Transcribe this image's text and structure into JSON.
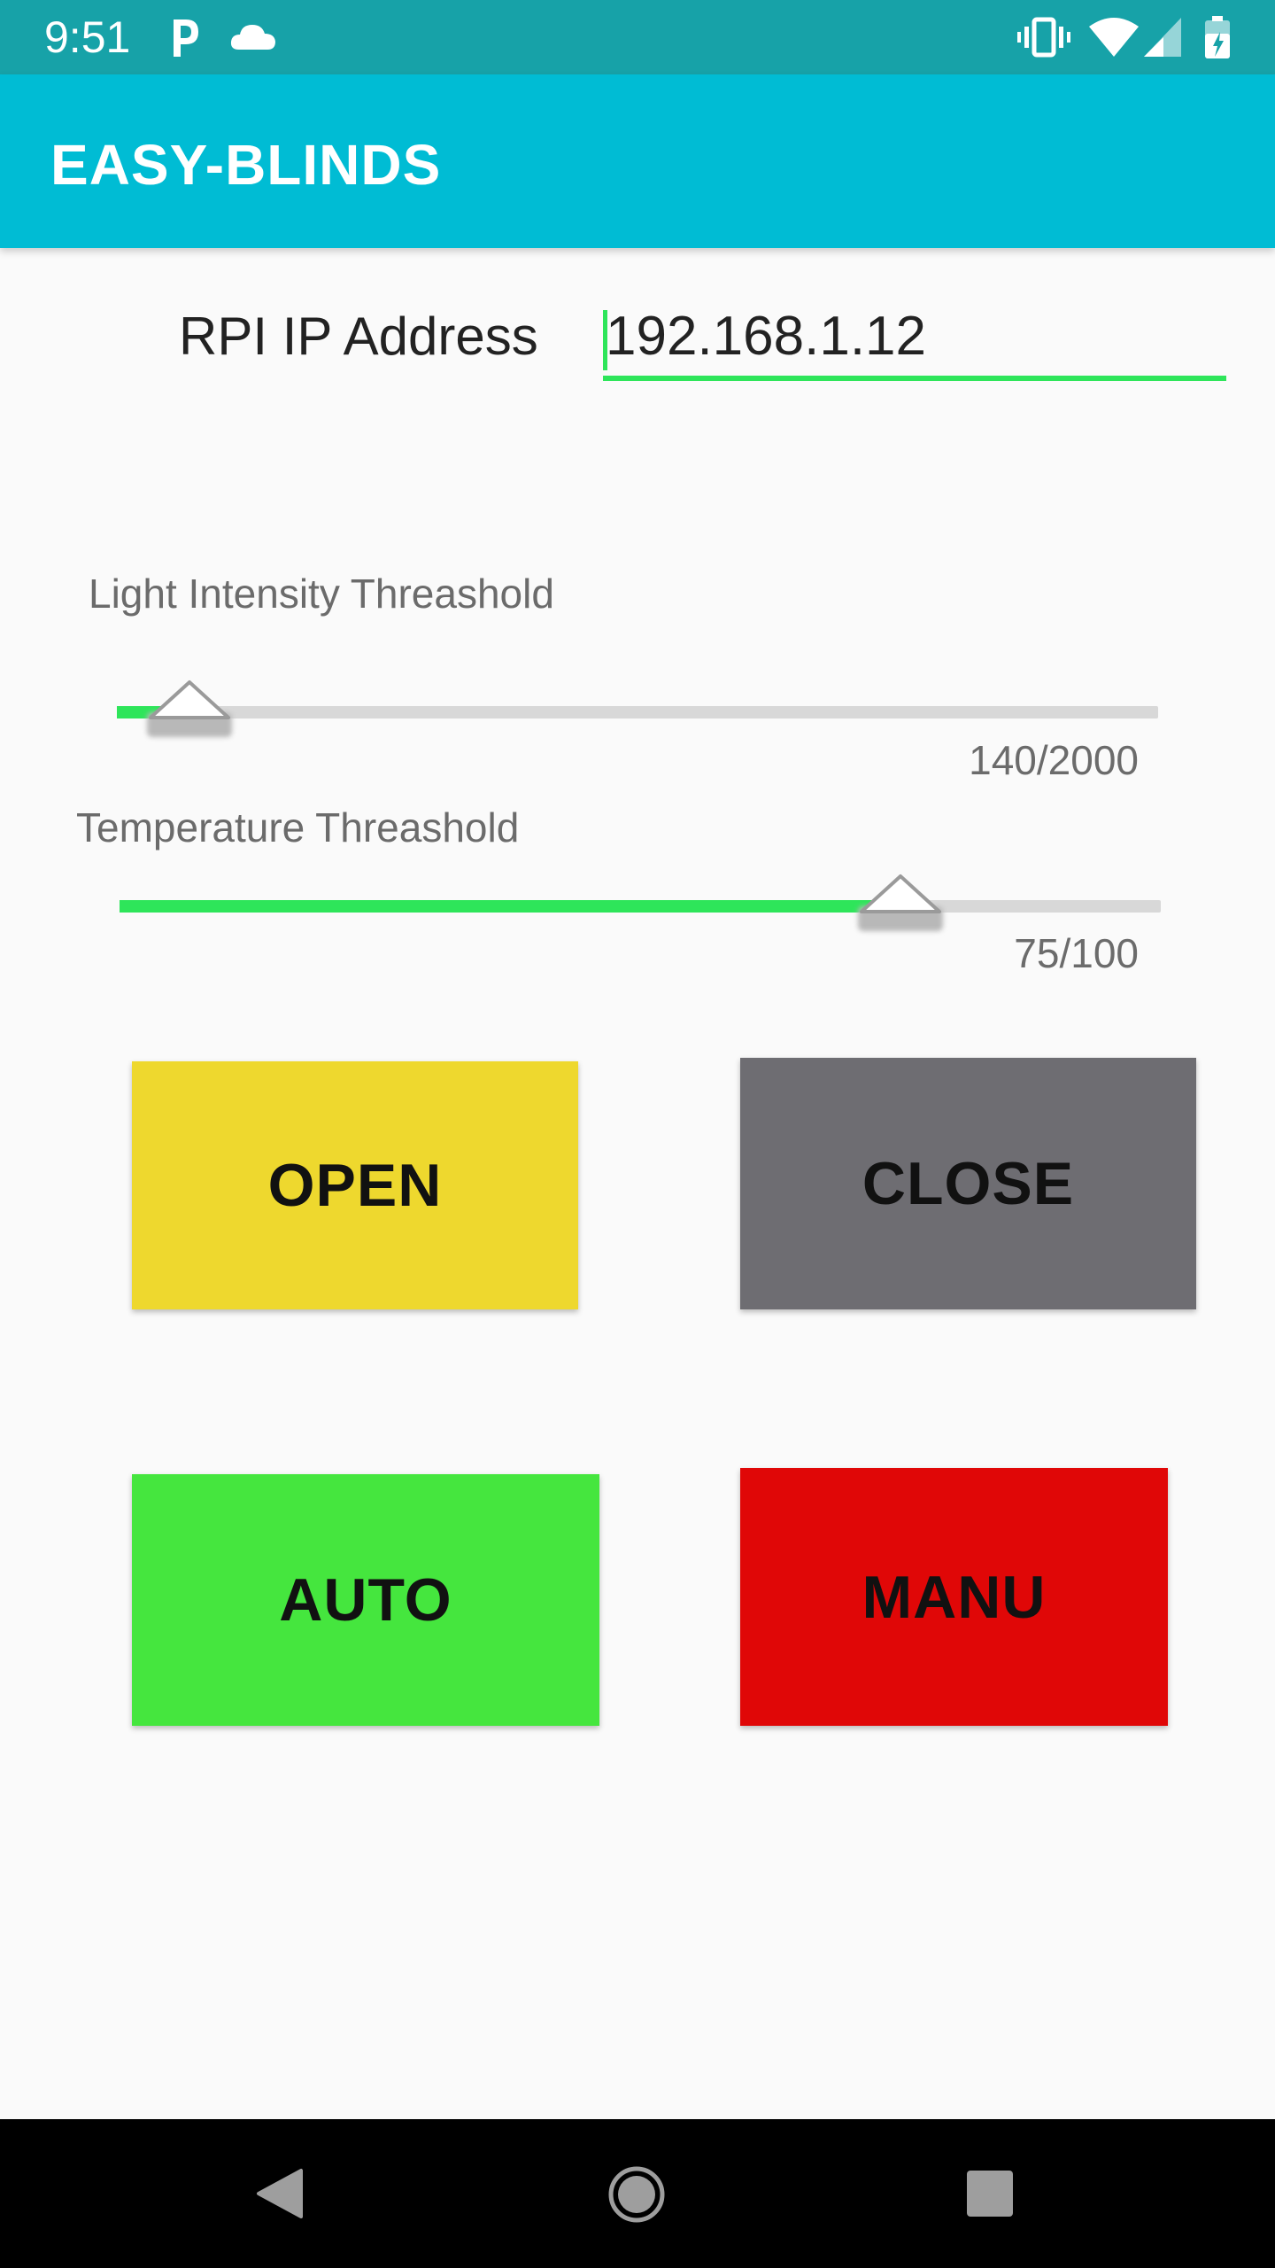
{
  "status_bar": {
    "time": "9:51",
    "icons": [
      "parking-app-icon",
      "cloud-icon",
      "vibrate-icon",
      "wifi-icon",
      "cell-signal-icon",
      "battery-icon"
    ]
  },
  "app_bar": {
    "title": "EASY-BLINDS",
    "color": "#00bcd4"
  },
  "ip": {
    "label": "RPI IP Address",
    "value": "192.168.1.12"
  },
  "light": {
    "label": "Light Intensity Threashold",
    "value_text": "140/2000",
    "value": 140,
    "max": 2000
  },
  "temperature": {
    "label": "Temperature Threashold",
    "value_text": "75/100",
    "value": 75,
    "max": 100
  },
  "buttons": {
    "open": {
      "label": "OPEN",
      "color": "#eed82e"
    },
    "close": {
      "label": "CLOSE",
      "color": "#6e6d72"
    },
    "auto": {
      "label": "AUTO",
      "color": "#45e63e"
    },
    "manu": {
      "label": "MANU",
      "color": "#e00707"
    }
  },
  "accent_color": "#2ee55a",
  "nav_bar": {
    "icons": [
      "back-icon",
      "home-icon",
      "recents-icon"
    ]
  }
}
